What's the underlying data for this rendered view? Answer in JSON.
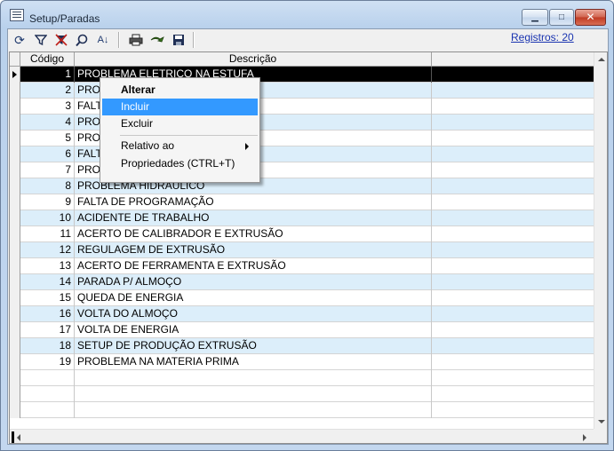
{
  "window": {
    "title": "Setup/Paradas",
    "minimize": "▁",
    "maximize": "□",
    "close": "✕"
  },
  "toolbar": {
    "records_label": "Registros: 20",
    "icons": [
      "refresh-icon",
      "filter-icon",
      "clear-filter-icon",
      "find-icon",
      "sort-icon",
      "print-icon",
      "export-icon",
      "save-icon"
    ]
  },
  "grid": {
    "columns": [
      "Código",
      "Descrição"
    ],
    "rows": [
      {
        "code": "1",
        "desc": "PROBLEMA ELETRICO NA ESTUFA"
      },
      {
        "code": "2",
        "desc": "PRO"
      },
      {
        "code": "3",
        "desc": "FALT"
      },
      {
        "code": "4",
        "desc": "PRO"
      },
      {
        "code": "5",
        "desc": "PRO"
      },
      {
        "code": "6",
        "desc": "FALT"
      },
      {
        "code": "7",
        "desc": "PRO"
      },
      {
        "code": "8",
        "desc": "PROBLEMA HIDRAULICO"
      },
      {
        "code": "9",
        "desc": "FALTA DE PROGRAMAÇÃO"
      },
      {
        "code": "10",
        "desc": "ACIDENTE DE TRABALHO"
      },
      {
        "code": "11",
        "desc": "ACERTO DE CALIBRADOR E EXTRUSÃO"
      },
      {
        "code": "12",
        "desc": "REGULAGEM DE EXTRUSÃO"
      },
      {
        "code": "13",
        "desc": "ACERTO DE FERRAMENTA E EXTRUSÃO"
      },
      {
        "code": "14",
        "desc": "PARADA P/ ALMOÇO"
      },
      {
        "code": "15",
        "desc": "QUEDA DE ENERGIA"
      },
      {
        "code": "16",
        "desc": "VOLTA DO ALMOÇO"
      },
      {
        "code": "17",
        "desc": "VOLTA DE ENERGIA"
      },
      {
        "code": "18",
        "desc": "SETUP DE PRODUÇÃO EXTRUSÃO"
      },
      {
        "code": "19",
        "desc": "PROBLEMA NA MATERIA PRIMA"
      }
    ]
  },
  "context_menu": {
    "alterar": "Alterar",
    "incluir": "Incluir",
    "excluir": "Excluir",
    "relativo": "Relativo ao",
    "propriedades": "Propriedades (CTRL+T)"
  },
  "colors": {
    "selection": "#000000",
    "alt_row": "#dceefa",
    "menu_highlight": "#3399ff",
    "link": "#1a34b0"
  }
}
